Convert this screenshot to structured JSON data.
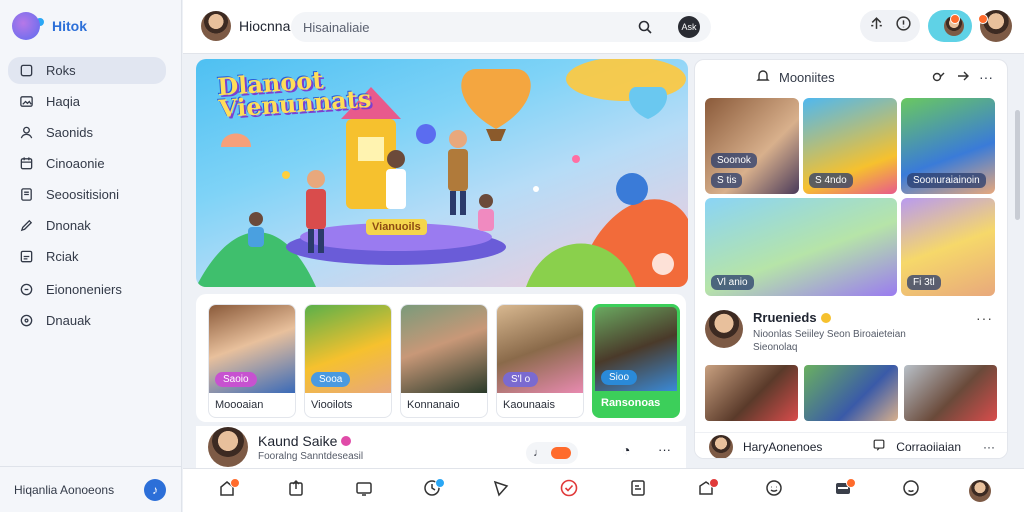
{
  "app": {
    "brand_name": "Hitok"
  },
  "sidebar": {
    "items": [
      {
        "label": "Roks",
        "icon": "home-icon",
        "active": true
      },
      {
        "label": "Haqia",
        "icon": "photo-icon"
      },
      {
        "label": "Saonids",
        "icon": "user-icon"
      },
      {
        "label": "Cinoaonie",
        "icon": "calendar-icon"
      },
      {
        "label": "Seoositisioni",
        "icon": "folder-icon"
      },
      {
        "label": "Dnonak",
        "icon": "gear-icon"
      },
      {
        "label": "Rciak",
        "icon": "document-icon"
      },
      {
        "label": "Eiononeniers",
        "icon": "bell-icon"
      },
      {
        "label": "Dnauak",
        "icon": "compass-icon"
      }
    ],
    "footer": {
      "label": "Hiqanlia Aonoeons",
      "button_icon": "music-icon"
    }
  },
  "topbar": {
    "profile_name": "Hiocnna",
    "search_value": "Hisainaliaie",
    "search_go_label": "Ask"
  },
  "hero": {
    "title_line1": "Dlanoot",
    "title_line2": "Vienunnats",
    "caption": "Vianuoils"
  },
  "right_panel": {
    "title": "Mooniites",
    "gallery_tags": [
      "Soonok",
      "S tis",
      "S 4ndo",
      "Soonuraiainoin",
      "Vl anio",
      "Fi 3tl"
    ],
    "card": {
      "name": "Rruenieds",
      "meta_line1": "Nioonlas Seiiley Seon Biroaieteian",
      "meta_line2": "Sieonolaq"
    },
    "footer": {
      "label": "HaryAonenoes",
      "action": "Corraoiiaian"
    }
  },
  "stories": [
    {
      "pill": "Saoio",
      "label": "Moooaian"
    },
    {
      "pill": "Sooa",
      "label": "Viooilots"
    },
    {
      "pill": "",
      "label": "Konnanaio"
    },
    {
      "pill": "S'l o",
      "label": "Kaounaais"
    },
    {
      "pill": "Sioo",
      "label": "Ransonoas",
      "highlight": true
    }
  ],
  "post": {
    "name": "Kaund Saike",
    "meta": "Fooralng Sanntdeseasil"
  },
  "bottom_nav": [
    {
      "icon": "home-icon",
      "badge": true
    },
    {
      "icon": "upload-icon"
    },
    {
      "icon": "video-icon"
    },
    {
      "icon": "clock-icon",
      "badge": true
    },
    {
      "icon": "flag-icon"
    },
    {
      "icon": "check-circle-icon",
      "active": true
    },
    {
      "icon": "page-icon"
    },
    {
      "icon": "chat-icon",
      "badge": true
    },
    {
      "icon": "emoji-icon"
    },
    {
      "icon": "media-icon",
      "badge": true
    },
    {
      "icon": "smile-icon"
    },
    {
      "icon": "profile-avatar"
    }
  ],
  "colors": {
    "accent": "#2c6fd8",
    "badge": "#ff6b2c",
    "active": "#e03a3a",
    "highlight": "#3ccf5a",
    "teal": "#5fd2e6"
  }
}
